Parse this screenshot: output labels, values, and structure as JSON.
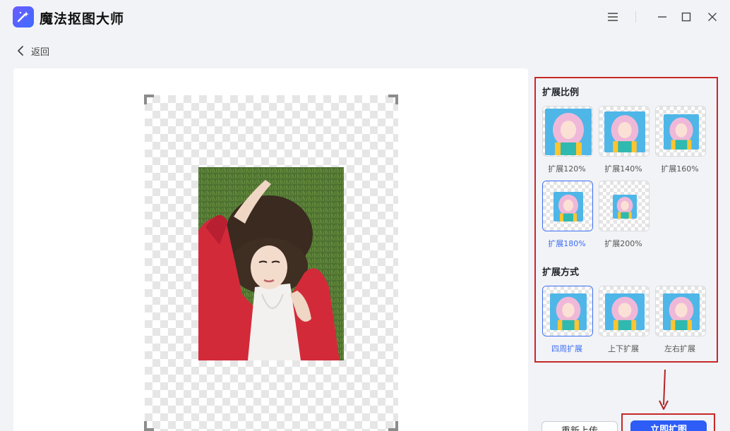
{
  "app": {
    "title": "魔法抠图大师"
  },
  "nav": {
    "back_label": "返回"
  },
  "panel": {
    "ratio_title": "扩展比例",
    "ratio_options": [
      {
        "label": "扩展120%",
        "selected": false
      },
      {
        "label": "扩展140%",
        "selected": false
      },
      {
        "label": "扩展160%",
        "selected": false
      },
      {
        "label": "扩展180%",
        "selected": true
      },
      {
        "label": "扩展200%",
        "selected": false
      }
    ],
    "mode_title": "扩展方式",
    "mode_options": [
      {
        "label": "四周扩展",
        "selected": true
      },
      {
        "label": "上下扩展",
        "selected": false
      },
      {
        "label": "左右扩展",
        "selected": false
      }
    ]
  },
  "footer": {
    "secondary_label": "重新上传",
    "primary_label": "立即扩图"
  },
  "colors": {
    "accent": "#2d5df6",
    "highlight": "#c62828",
    "selected": "#3b6ef5"
  }
}
